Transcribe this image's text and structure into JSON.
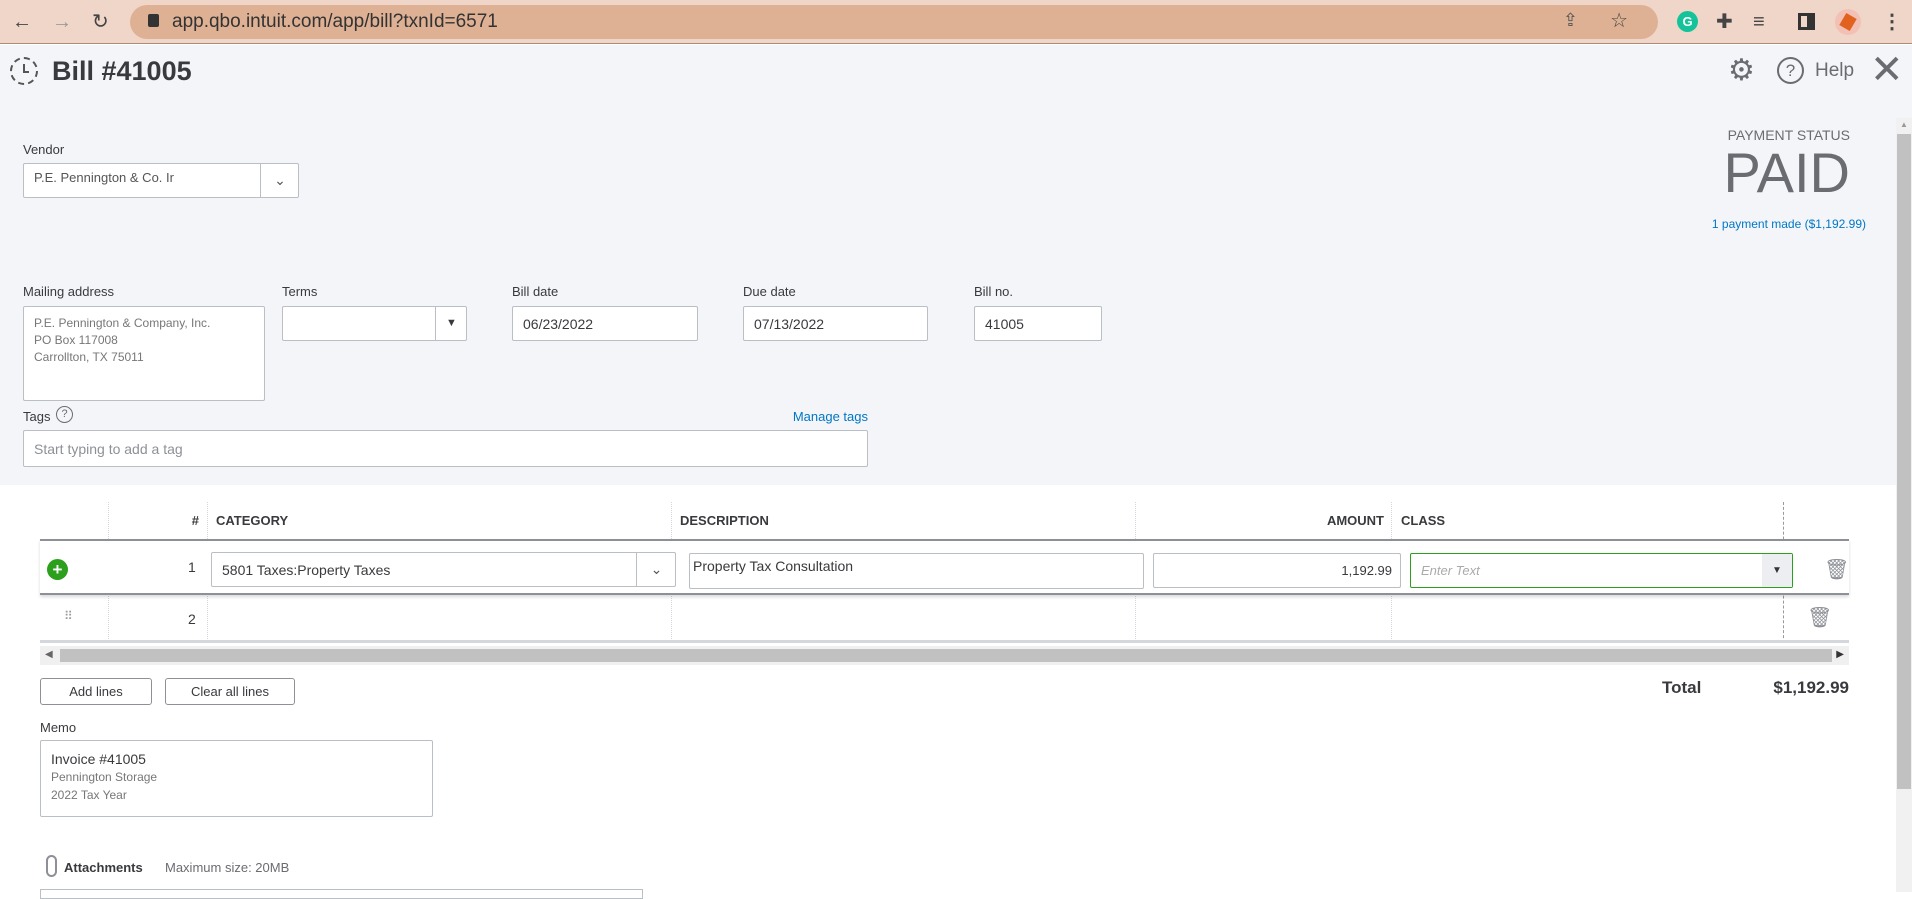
{
  "browser": {
    "url": "app.qbo.intuit.com/app/bill?txnId=6571"
  },
  "header": {
    "title": "Bill #41005",
    "help_label": "Help"
  },
  "payment": {
    "status_label": "PAYMENT STATUS",
    "status": "PAID",
    "payments_link": "1 payment made ($1,192.99)"
  },
  "form": {
    "vendor_label": "Vendor",
    "vendor_value": "P.E. Pennington & Co. Ir",
    "mailing_label": "Mailing address",
    "mailing_lines": [
      "P.E. Pennington & Company, Inc.",
      "PO Box 117008",
      "Carrollton, TX 75011"
    ],
    "terms_label": "Terms",
    "terms_value": "",
    "bill_date_label": "Bill date",
    "bill_date": "06/23/2022",
    "due_date_label": "Due date",
    "due_date": "07/13/2022",
    "bill_no_label": "Bill no.",
    "bill_no": "41005",
    "tags_label": "Tags",
    "manage_tags": "Manage tags",
    "tags_placeholder": "Start typing to add a tag"
  },
  "table": {
    "headers": {
      "num": "#",
      "category": "CATEGORY",
      "description": "DESCRIPTION",
      "amount": "AMOUNT",
      "class": "CLASS"
    },
    "rows": [
      {
        "num": "1",
        "category": "5801 Taxes:Property Taxes",
        "description": "Property Tax Consultation",
        "amount": "1,192.99",
        "class_placeholder": "Enter Text"
      },
      {
        "num": "2",
        "category": "",
        "description": "",
        "amount": ""
      }
    ]
  },
  "actions": {
    "add_lines": "Add lines",
    "clear_lines": "Clear all lines"
  },
  "total": {
    "label": "Total",
    "value": "$1,192.99"
  },
  "memo": {
    "label": "Memo",
    "lines": [
      "Invoice #41005",
      "Pennington Storage",
      "2022 Tax Year"
    ]
  },
  "attachments": {
    "label": "Attachments",
    "max_size": "Maximum size: 20MB"
  }
}
